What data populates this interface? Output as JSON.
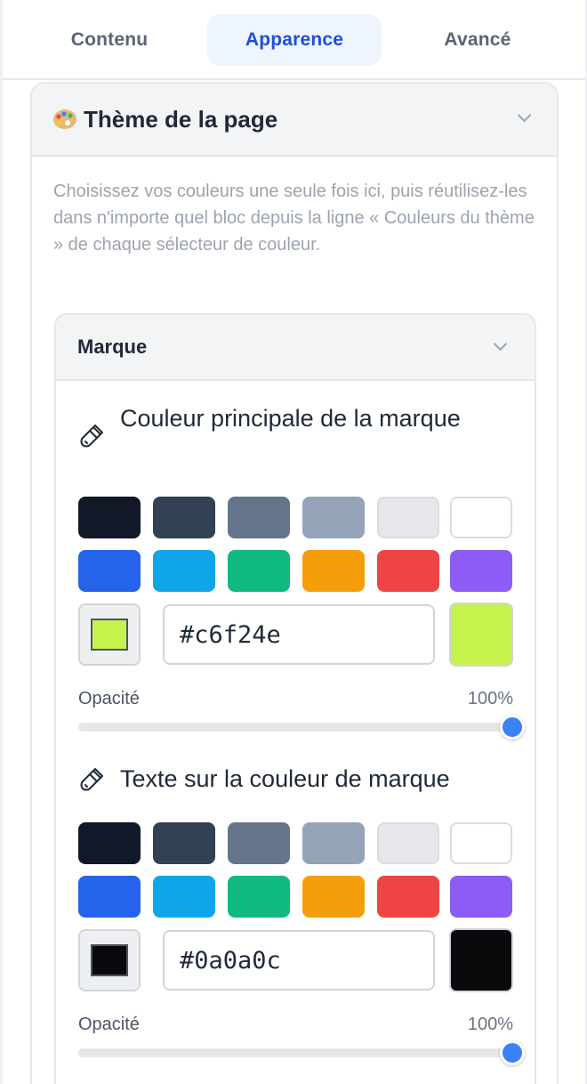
{
  "tabs": [
    {
      "label": "Contenu",
      "active": false
    },
    {
      "label": "Apparence",
      "active": true
    },
    {
      "label": "Avancé",
      "active": false
    }
  ],
  "theme_panel": {
    "icon": "palette-emoji-icon",
    "title": "Thème de la page",
    "description": "Choisissez vos couleurs une seule fois ici, puis réutilisez-les dans n'importe quel bloc depuis la ligne « Couleurs du thème » de chaque sélecteur de couleur."
  },
  "brand_section": {
    "title": "Marque",
    "fields": [
      {
        "label": "Couleur principale de la marque",
        "icon": "paintbrush-icon",
        "swatches": [
          "#111827",
          "#334155",
          "#64748b",
          "#94a3b8",
          "#e5e7eb",
          "#ffffff",
          "#2563eb",
          "#0ea5e9",
          "#10b981",
          "#f59e0b",
          "#ef4444",
          "#8b5cf6"
        ],
        "hex_value": "#c6f24e",
        "color": "#c6f24e",
        "opacity_label": "Opacité",
        "opacity_value": "100%",
        "opacity": 1.0
      },
      {
        "label": "Texte sur la couleur de marque",
        "icon": "paintbrush-icon",
        "swatches": [
          "#111827",
          "#334155",
          "#64748b",
          "#94a3b8",
          "#e5e7eb",
          "#ffffff",
          "#2563eb",
          "#0ea5e9",
          "#10b981",
          "#f59e0b",
          "#ef4444",
          "#8b5cf6"
        ],
        "hex_value": "#0a0a0c",
        "color": "#0a0a0c",
        "opacity_label": "Opacité",
        "opacity_value": "100%",
        "opacity": 1.0
      }
    ]
  }
}
